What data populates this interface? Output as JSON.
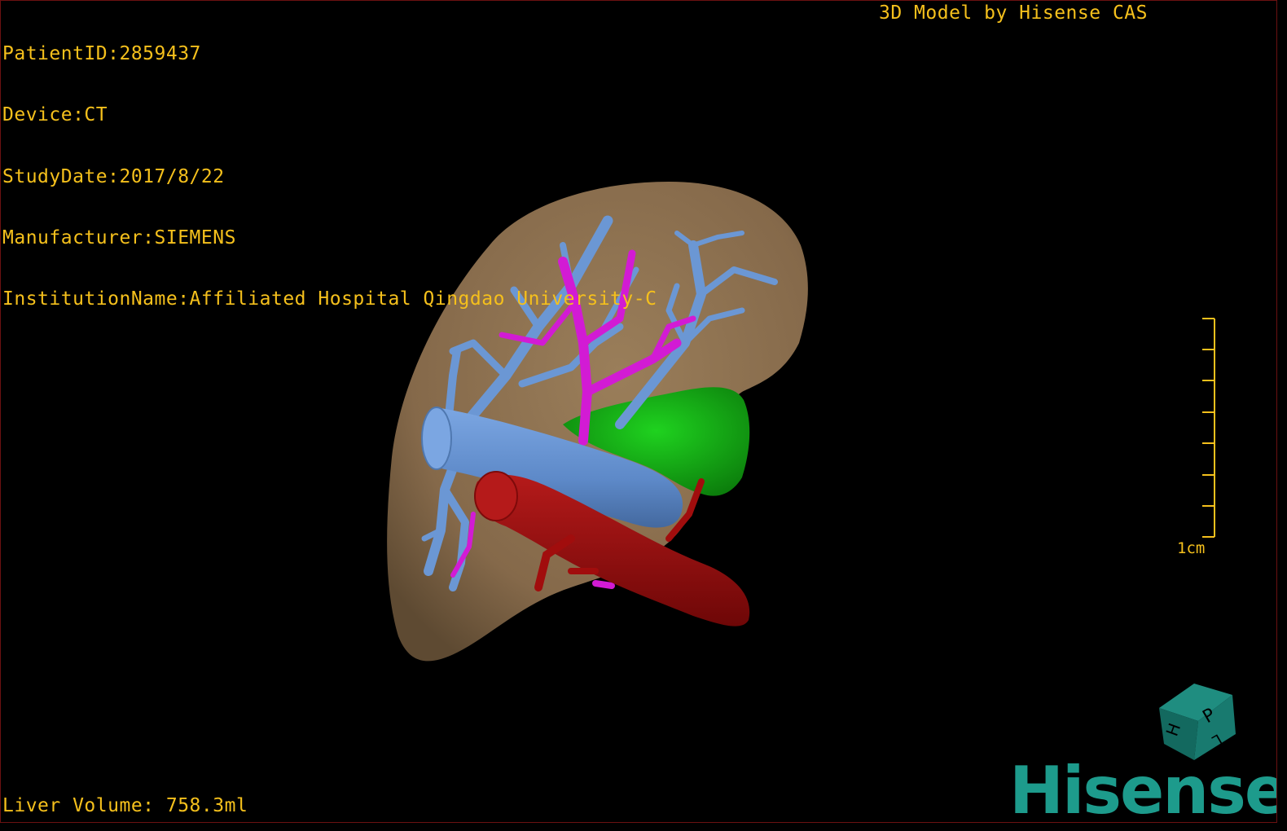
{
  "dicom": {
    "patient_id": "PatientID:2859437",
    "device": "Device:CT",
    "study_date": "StudyDate:2017/8/22",
    "manufacturer": "Manufacturer:SIEMENS",
    "institution": "InstitutionName:Affiliated Hospital Qingdao University-C"
  },
  "header": {
    "title": "3D Model by Hisense CAS"
  },
  "footer": {
    "volume": "Liver Volume: 758.3ml"
  },
  "scale_bar": {
    "label": "1cm"
  },
  "orientation_cube": {
    "faces": [
      "P",
      "H",
      "L"
    ]
  },
  "brand": {
    "name": "Hisense"
  },
  "colors": {
    "overlay_text": "#f5c01c",
    "liver": "#8f7452",
    "hepatic_vein": "#6b97d4",
    "portal_vein": "#d21bd4",
    "gallbladder": "#14b514",
    "artery": "#a10d0d",
    "brand": "#1d9b8c"
  }
}
